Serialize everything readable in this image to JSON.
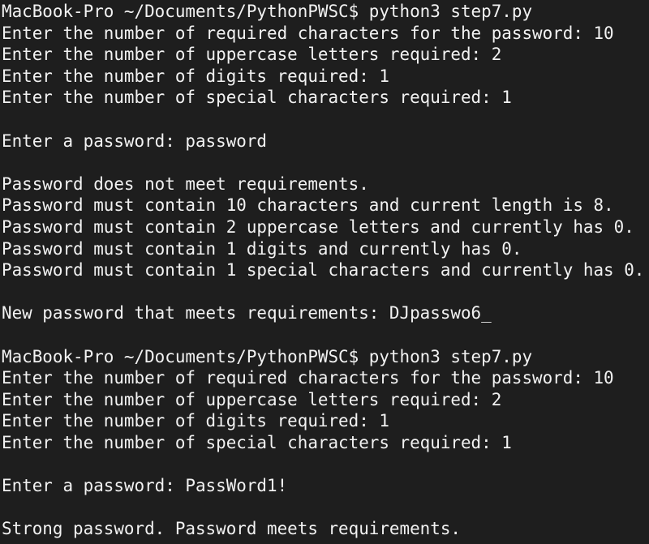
{
  "terminal": {
    "colors": {
      "background": "#1e1e1e",
      "text": "#f2f2f2"
    },
    "lines": [
      "MacBook-Pro ~/Documents/PythonPWSC$ python3 step7.py",
      "Enter the number of required characters for the password: 10",
      "Enter the number of uppercase letters required: 2",
      "Enter the number of digits required: 1",
      "Enter the number of special characters required: 1",
      "",
      "Enter a password: password",
      "",
      "Password does not meet requirements.",
      "Password must contain 10 characters and current length is 8.",
      "Password must contain 2 uppercase letters and currently has 0.",
      "Password must contain 1 digits and currently has 0.",
      "Password must contain 1 special characters and currently has 0.",
      "",
      "New password that meets requirements: DJpasswo6_",
      "",
      "MacBook-Pro ~/Documents/PythonPWSC$ python3 step7.py",
      "Enter the number of required characters for the password: 10",
      "Enter the number of uppercase letters required: 2",
      "Enter the number of digits required: 1",
      "Enter the number of special characters required: 1",
      "",
      "Enter a password: PassWord1!",
      "",
      "Strong password. Password meets requirements."
    ]
  }
}
